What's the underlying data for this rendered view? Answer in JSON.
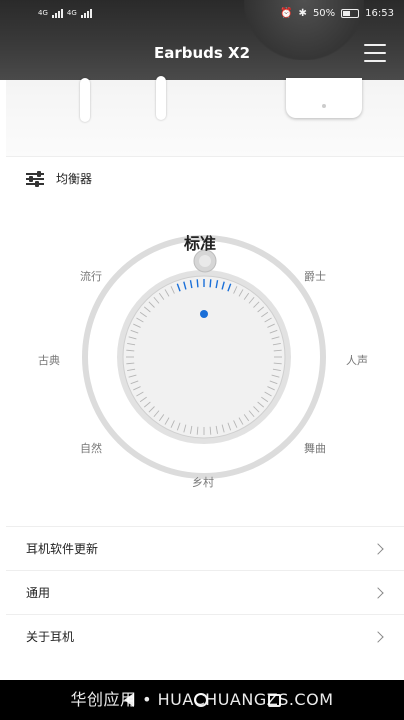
{
  "status_bar": {
    "network_left": "4G",
    "network_right": "4G",
    "battery": "50%",
    "time": "16:53"
  },
  "header": {
    "title": "Earbuds X2"
  },
  "equalizer": {
    "label": "均衡器",
    "active_preset": "标准",
    "presets": {
      "pop": "流行",
      "jazz": "爵士",
      "classical": "古典",
      "vocal": "人声",
      "natural": "自然",
      "dance": "舞曲",
      "country": "乡村"
    }
  },
  "menu": {
    "items": [
      {
        "label": "耳机软件更新"
      },
      {
        "label": "通用"
      },
      {
        "label": "关于耳机"
      }
    ]
  },
  "watermark": "华创应用 • HUACHUANGZS.COM",
  "colors": {
    "accent": "#1a6fd8",
    "dial_ring": "#d8d8d8",
    "inner_dial": "#ececec"
  }
}
